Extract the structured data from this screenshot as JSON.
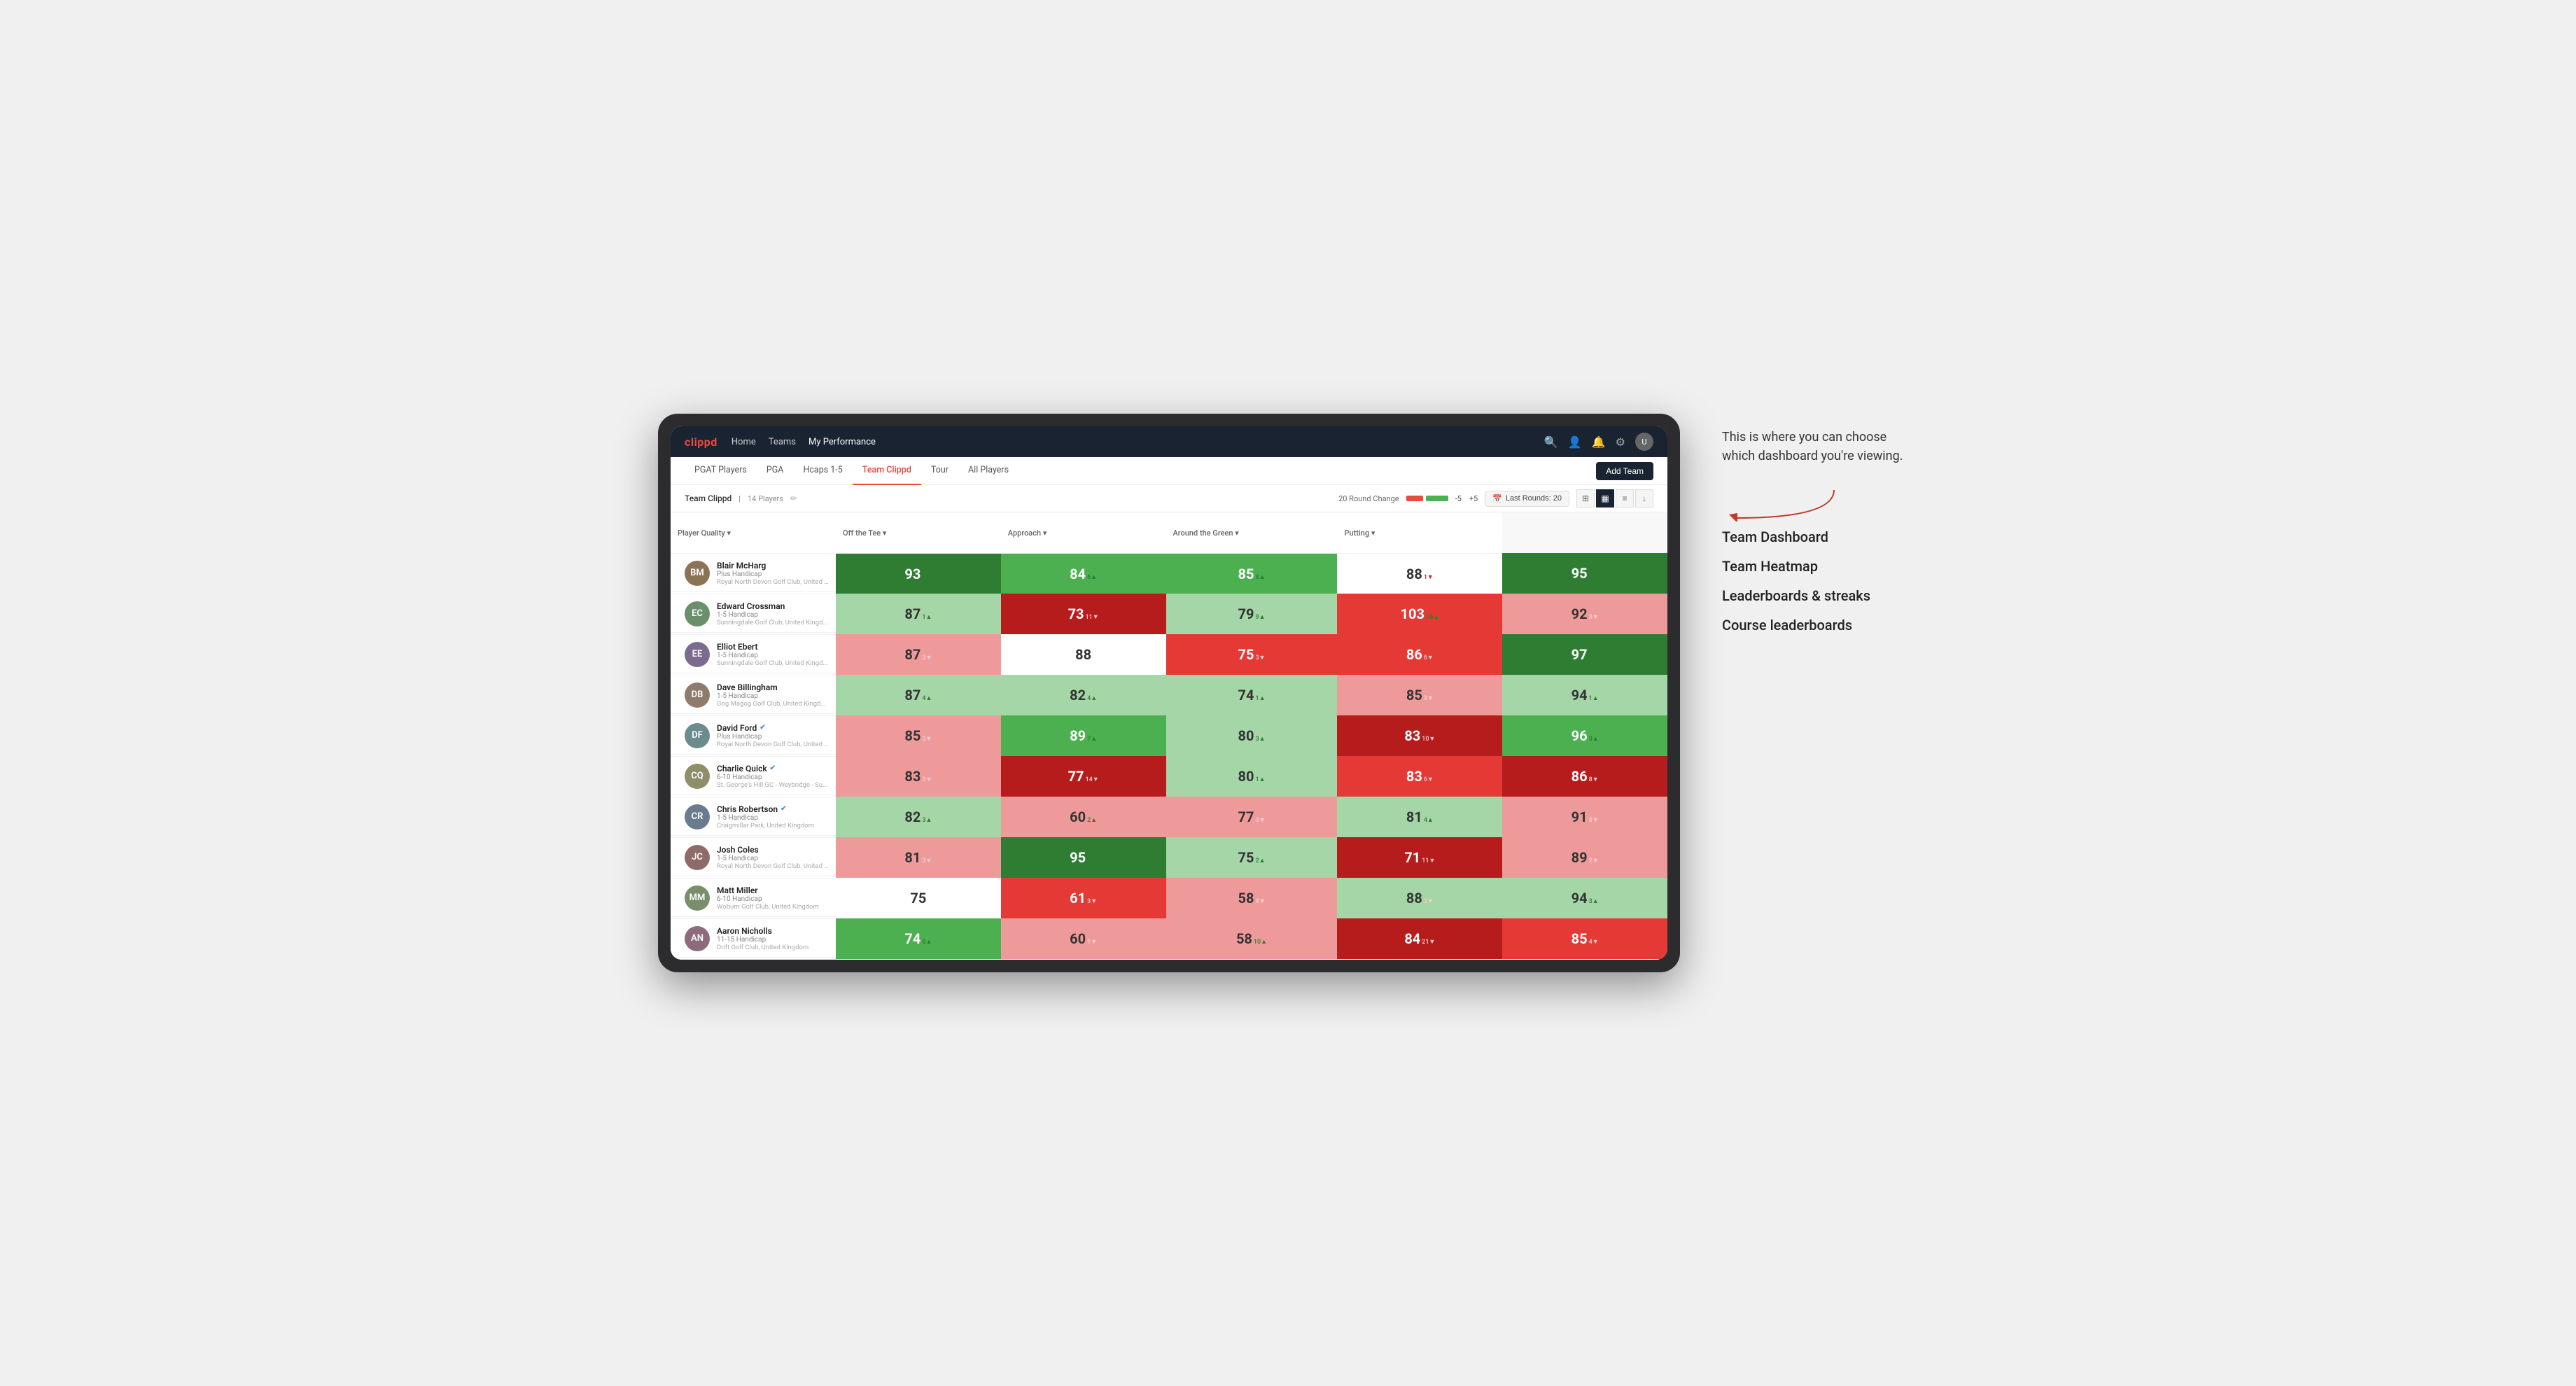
{
  "annotation": {
    "intro_text": "This is where you can choose which dashboard you're viewing.",
    "options": [
      "Team Dashboard",
      "Team Heatmap",
      "Leaderboards & streaks",
      "Course leaderboards"
    ]
  },
  "nav": {
    "logo": "clippd",
    "links": [
      "Home",
      "Teams",
      "My Performance"
    ],
    "active_link": "My Performance"
  },
  "sub_tabs": [
    "PGAT Players",
    "PGA",
    "Hcaps 1-5",
    "Team Clippd",
    "Tour",
    "All Players"
  ],
  "active_sub_tab": "Team Clippd",
  "add_team_label": "Add Team",
  "team_header": {
    "name": "Team Clippd",
    "separator": "|",
    "count_label": "14 Players",
    "round_change_label": "20 Round Change",
    "neg_value": "-5",
    "pos_value": "+5",
    "last_rounds_label": "Last Rounds:",
    "last_rounds_value": "20"
  },
  "table": {
    "columns": [
      "Player Quality ▾",
      "Off the Tee ▾",
      "Approach ▾",
      "Around the Green ▾",
      "Putting ▾"
    ],
    "rows": [
      {
        "name": "Blair McHarg",
        "handicap": "Plus Handicap",
        "club": "Royal North Devon Golf Club, United Kingdom",
        "avatar_color": "#8B7355",
        "initials": "BM",
        "verified": false,
        "metrics": [
          {
            "value": "93",
            "change": "9",
            "direction": "up",
            "bg": "green-strong"
          },
          {
            "value": "84",
            "change": "6",
            "direction": "up",
            "bg": "green-mid"
          },
          {
            "value": "85",
            "change": "8",
            "direction": "up",
            "bg": "green-mid"
          },
          {
            "value": "88",
            "change": "1",
            "direction": "down",
            "bg": "white"
          },
          {
            "value": "95",
            "change": "9",
            "direction": "up",
            "bg": "green-strong"
          }
        ]
      },
      {
        "name": "Edward Crossman",
        "handicap": "1-5 Handicap",
        "club": "Sunningdale Golf Club, United Kingdom",
        "avatar_color": "#6B8E6B",
        "initials": "EC",
        "verified": false,
        "metrics": [
          {
            "value": "87",
            "change": "1",
            "direction": "up",
            "bg": "green-light"
          },
          {
            "value": "73",
            "change": "11",
            "direction": "down",
            "bg": "red-strong"
          },
          {
            "value": "79",
            "change": "9",
            "direction": "up",
            "bg": "green-light"
          },
          {
            "value": "103",
            "change": "15",
            "direction": "up",
            "bg": "red-mid"
          },
          {
            "value": "92",
            "change": "3",
            "direction": "down",
            "bg": "red-light"
          }
        ]
      },
      {
        "name": "Elliot Ebert",
        "handicap": "1-5 Handicap",
        "club": "Sunningdale Golf Club, United Kingdom",
        "avatar_color": "#7B6B8E",
        "initials": "EE",
        "verified": false,
        "metrics": [
          {
            "value": "87",
            "change": "3",
            "direction": "down",
            "bg": "red-light"
          },
          {
            "value": "88",
            "change": "",
            "direction": "none",
            "bg": "white"
          },
          {
            "value": "75",
            "change": "3",
            "direction": "down",
            "bg": "red-mid"
          },
          {
            "value": "86",
            "change": "6",
            "direction": "down",
            "bg": "red-mid"
          },
          {
            "value": "97",
            "change": "5",
            "direction": "up",
            "bg": "green-strong"
          }
        ]
      },
      {
        "name": "Dave Billingham",
        "handicap": "1-5 Handicap",
        "club": "Gog Magog Golf Club, United Kingdom",
        "avatar_color": "#8E7B6B",
        "initials": "DB",
        "verified": false,
        "metrics": [
          {
            "value": "87",
            "change": "4",
            "direction": "up",
            "bg": "green-light"
          },
          {
            "value": "82",
            "change": "4",
            "direction": "up",
            "bg": "green-light"
          },
          {
            "value": "74",
            "change": "1",
            "direction": "up",
            "bg": "green-light"
          },
          {
            "value": "85",
            "change": "3",
            "direction": "down",
            "bg": "red-light"
          },
          {
            "value": "94",
            "change": "1",
            "direction": "up",
            "bg": "green-light"
          }
        ]
      },
      {
        "name": "David Ford",
        "handicap": "Plus Handicap",
        "club": "Royal North Devon Golf Club, United Kingdom",
        "avatar_color": "#6B8B8E",
        "initials": "DF",
        "verified": true,
        "metrics": [
          {
            "value": "85",
            "change": "3",
            "direction": "down",
            "bg": "red-light"
          },
          {
            "value": "89",
            "change": "7",
            "direction": "up",
            "bg": "green-mid"
          },
          {
            "value": "80",
            "change": "3",
            "direction": "up",
            "bg": "green-light"
          },
          {
            "value": "83",
            "change": "10",
            "direction": "down",
            "bg": "red-strong"
          },
          {
            "value": "96",
            "change": "3",
            "direction": "up",
            "bg": "green-mid"
          }
        ]
      },
      {
        "name": "Charlie Quick",
        "handicap": "6-10 Handicap",
        "club": "St. George's Hill GC - Weybridge - Surrey, Uni...",
        "avatar_color": "#8E8E6B",
        "initials": "CQ",
        "verified": true,
        "metrics": [
          {
            "value": "83",
            "change": "3",
            "direction": "down",
            "bg": "red-light"
          },
          {
            "value": "77",
            "change": "14",
            "direction": "down",
            "bg": "red-strong"
          },
          {
            "value": "80",
            "change": "1",
            "direction": "up",
            "bg": "green-light"
          },
          {
            "value": "83",
            "change": "6",
            "direction": "down",
            "bg": "red-mid"
          },
          {
            "value": "86",
            "change": "8",
            "direction": "down",
            "bg": "red-strong"
          }
        ]
      },
      {
        "name": "Chris Robertson",
        "handicap": "1-5 Handicap",
        "club": "Craigmillar Park, United Kingdom",
        "avatar_color": "#6B7B8E",
        "initials": "CR",
        "verified": true,
        "metrics": [
          {
            "value": "82",
            "change": "3",
            "direction": "up",
            "bg": "green-light"
          },
          {
            "value": "60",
            "change": "2",
            "direction": "up",
            "bg": "red-light"
          },
          {
            "value": "77",
            "change": "3",
            "direction": "down",
            "bg": "red-light"
          },
          {
            "value": "81",
            "change": "4",
            "direction": "up",
            "bg": "green-light"
          },
          {
            "value": "91",
            "change": "3",
            "direction": "down",
            "bg": "red-light"
          }
        ]
      },
      {
        "name": "Josh Coles",
        "handicap": "1-5 Handicap",
        "club": "Royal North Devon Golf Club, United Kingdom",
        "avatar_color": "#8E6B6B",
        "initials": "JC",
        "verified": false,
        "metrics": [
          {
            "value": "81",
            "change": "3",
            "direction": "down",
            "bg": "red-light"
          },
          {
            "value": "95",
            "change": "8",
            "direction": "up",
            "bg": "green-strong"
          },
          {
            "value": "75",
            "change": "2",
            "direction": "up",
            "bg": "green-light"
          },
          {
            "value": "71",
            "change": "11",
            "direction": "down",
            "bg": "red-strong"
          },
          {
            "value": "89",
            "change": "2",
            "direction": "down",
            "bg": "red-light"
          }
        ]
      },
      {
        "name": "Matt Miller",
        "handicap": "6-10 Handicap",
        "club": "Woburn Golf Club, United Kingdom",
        "avatar_color": "#7B8E6B",
        "initials": "MM",
        "verified": false,
        "metrics": [
          {
            "value": "75",
            "change": "",
            "direction": "none",
            "bg": "white"
          },
          {
            "value": "61",
            "change": "3",
            "direction": "down",
            "bg": "red-mid"
          },
          {
            "value": "58",
            "change": "4",
            "direction": "down",
            "bg": "red-light"
          },
          {
            "value": "88",
            "change": "2",
            "direction": "down",
            "bg": "green-light"
          },
          {
            "value": "94",
            "change": "3",
            "direction": "up",
            "bg": "green-light"
          }
        ]
      },
      {
        "name": "Aaron Nicholls",
        "handicap": "11-15 Handicap",
        "club": "Drift Golf Club, United Kingdom",
        "avatar_color": "#8E6B7B",
        "initials": "AN",
        "verified": false,
        "metrics": [
          {
            "value": "74",
            "change": "8",
            "direction": "up",
            "bg": "green-mid"
          },
          {
            "value": "60",
            "change": "1",
            "direction": "down",
            "bg": "red-light"
          },
          {
            "value": "58",
            "change": "10",
            "direction": "up",
            "bg": "red-light"
          },
          {
            "value": "84",
            "change": "21",
            "direction": "down",
            "bg": "red-strong"
          },
          {
            "value": "85",
            "change": "4",
            "direction": "down",
            "bg": "red-mid"
          }
        ]
      }
    ]
  }
}
